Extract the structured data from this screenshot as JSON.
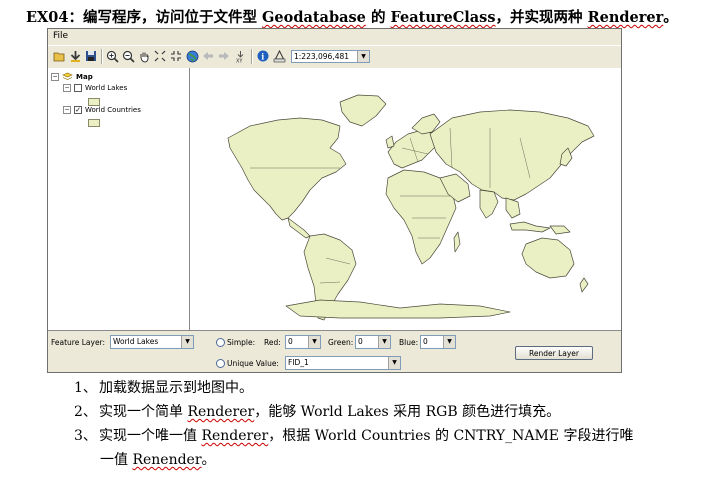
{
  "heading": {
    "label": "EX04：",
    "text_a": "编写程序，访问位于文件型",
    "kw_geodatabase": "Geodatabase",
    "text_b": "的",
    "kw_featureclass": "FeatureClass",
    "text_c": "，并实现两种",
    "kw_renderer": "Renderer",
    "text_d": "。"
  },
  "app": {
    "menu": {
      "file": "File"
    },
    "toolbar": {
      "icons": [
        "open-icon",
        "add-data-icon",
        "save-icon",
        "zoom-in-icon",
        "zoom-out-icon",
        "pan-icon",
        "fixed-zoom-in-icon",
        "fixed-zoom-out-icon",
        "full-extent-icon",
        "back-icon",
        "forward-icon",
        "go-to-xy-icon",
        "identify-icon",
        "measure-icon"
      ],
      "scale": "1:223,096,481"
    },
    "toc": {
      "root": "Map",
      "layers": [
        {
          "name": "World Lakes",
          "checked": false
        },
        {
          "name": "World Countries",
          "checked": true
        }
      ],
      "swatch_color": "#ebf0c4"
    },
    "map": {
      "land_color": "#ebf0c4",
      "outline_color": "#4a4a3a"
    },
    "panel": {
      "feature_layer_label": "Feature Layer:",
      "feature_layer_value": "World Lakes",
      "simple_label": "Simple:",
      "red_label": "Red:",
      "red_value": "0",
      "green_label": "Green:",
      "green_value": "0",
      "blue_label": "Blue:",
      "blue_value": "0",
      "unique_label": "Unique Value:",
      "unique_field": "FID_1",
      "render_button": "Render Layer"
    }
  },
  "tasks": [
    {
      "num": "1、",
      "text": "加载数据显示到地图中。"
    },
    {
      "num": "2、",
      "pre": "实现一个简单",
      "kw": "Renderer",
      "post": "，能够 World Lakes 采用 RGB 颜色进行填充。"
    },
    {
      "num": "3、",
      "pre": "实现一个唯一值",
      "kw": "Renderer",
      "post": "，根据 World Countries 的 CNTRY_NAME 字段进行唯",
      "cont_pre": "一值",
      "cont_kw": "Renender",
      "cont_post": "。"
    }
  ]
}
